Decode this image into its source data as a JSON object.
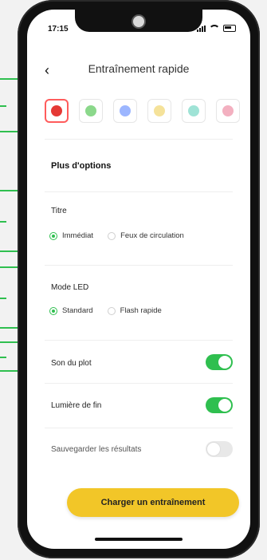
{
  "status": {
    "time": "17:15"
  },
  "header": {
    "back_glyph": "‹",
    "title": "Entraînement rapide"
  },
  "colors": {
    "swatches": [
      {
        "name": "red",
        "hex": "#e53935",
        "selected": true
      },
      {
        "name": "green",
        "hex": "#8bd88b",
        "selected": false
      },
      {
        "name": "blue",
        "hex": "#9cb6ff",
        "selected": false
      },
      {
        "name": "yellow",
        "hex": "#f5e29a",
        "selected": false
      },
      {
        "name": "teal",
        "hex": "#9fe3d6",
        "selected": false
      },
      {
        "name": "pink",
        "hex": "#f3b0c0",
        "selected": false
      }
    ],
    "accent": "#2fbf4f",
    "cta": "#f2c628"
  },
  "options": {
    "section_title": "Plus d'options",
    "titre": {
      "label": "Titre",
      "choices": [
        "Immédiat",
        "Feux de circulation"
      ],
      "selected": "Immédiat"
    },
    "led": {
      "label": "Mode LED",
      "choices": [
        "Standard",
        "Flash rapide"
      ],
      "selected": "Standard"
    },
    "son": {
      "label": "Son du plot",
      "on": true
    },
    "lumiere": {
      "label": "Lumière de fin",
      "on": true
    },
    "sauvegarder": {
      "label": "Sauvegarder les résultats",
      "on": false
    }
  },
  "cta": {
    "label": "Charger un entraînement"
  }
}
